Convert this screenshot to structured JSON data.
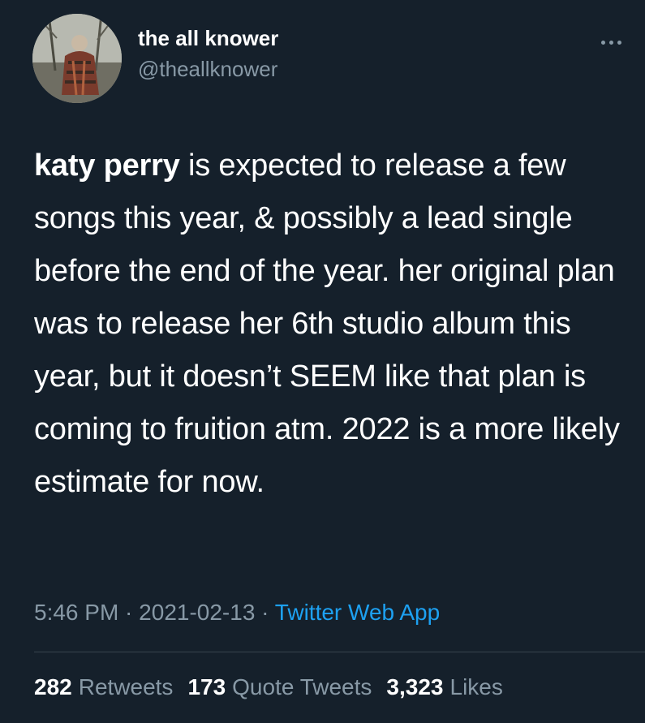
{
  "user": {
    "display_name": "the all knower",
    "handle": "@theallknower"
  },
  "tweet": {
    "mention": "katy perry",
    "text": " is expected to release a few songs this year, & possibly a lead single before the end of the year. her original plan was to release her 6th studio album this year, but it doesn’t SEEM like that plan is coming to fruition atm. 2022 is a more likely estimate for now."
  },
  "meta": {
    "time": "5:46 PM",
    "separator": " · ",
    "date": "2021-02-13",
    "source": "Twitter Web App"
  },
  "stats": {
    "retweets_count": "282",
    "retweets_label": "Retweets",
    "quotes_count": "173",
    "quotes_label": "Quote Tweets",
    "likes_count": "3,323",
    "likes_label": "Likes"
  },
  "icons": {
    "more": "more-horizontal-icon",
    "avatar": "profile-photo"
  },
  "colors": {
    "background": "#15202b",
    "primary_text": "#ffffff",
    "secondary_text": "#8899a6",
    "link": "#1da1f2",
    "divider": "#38444d"
  }
}
